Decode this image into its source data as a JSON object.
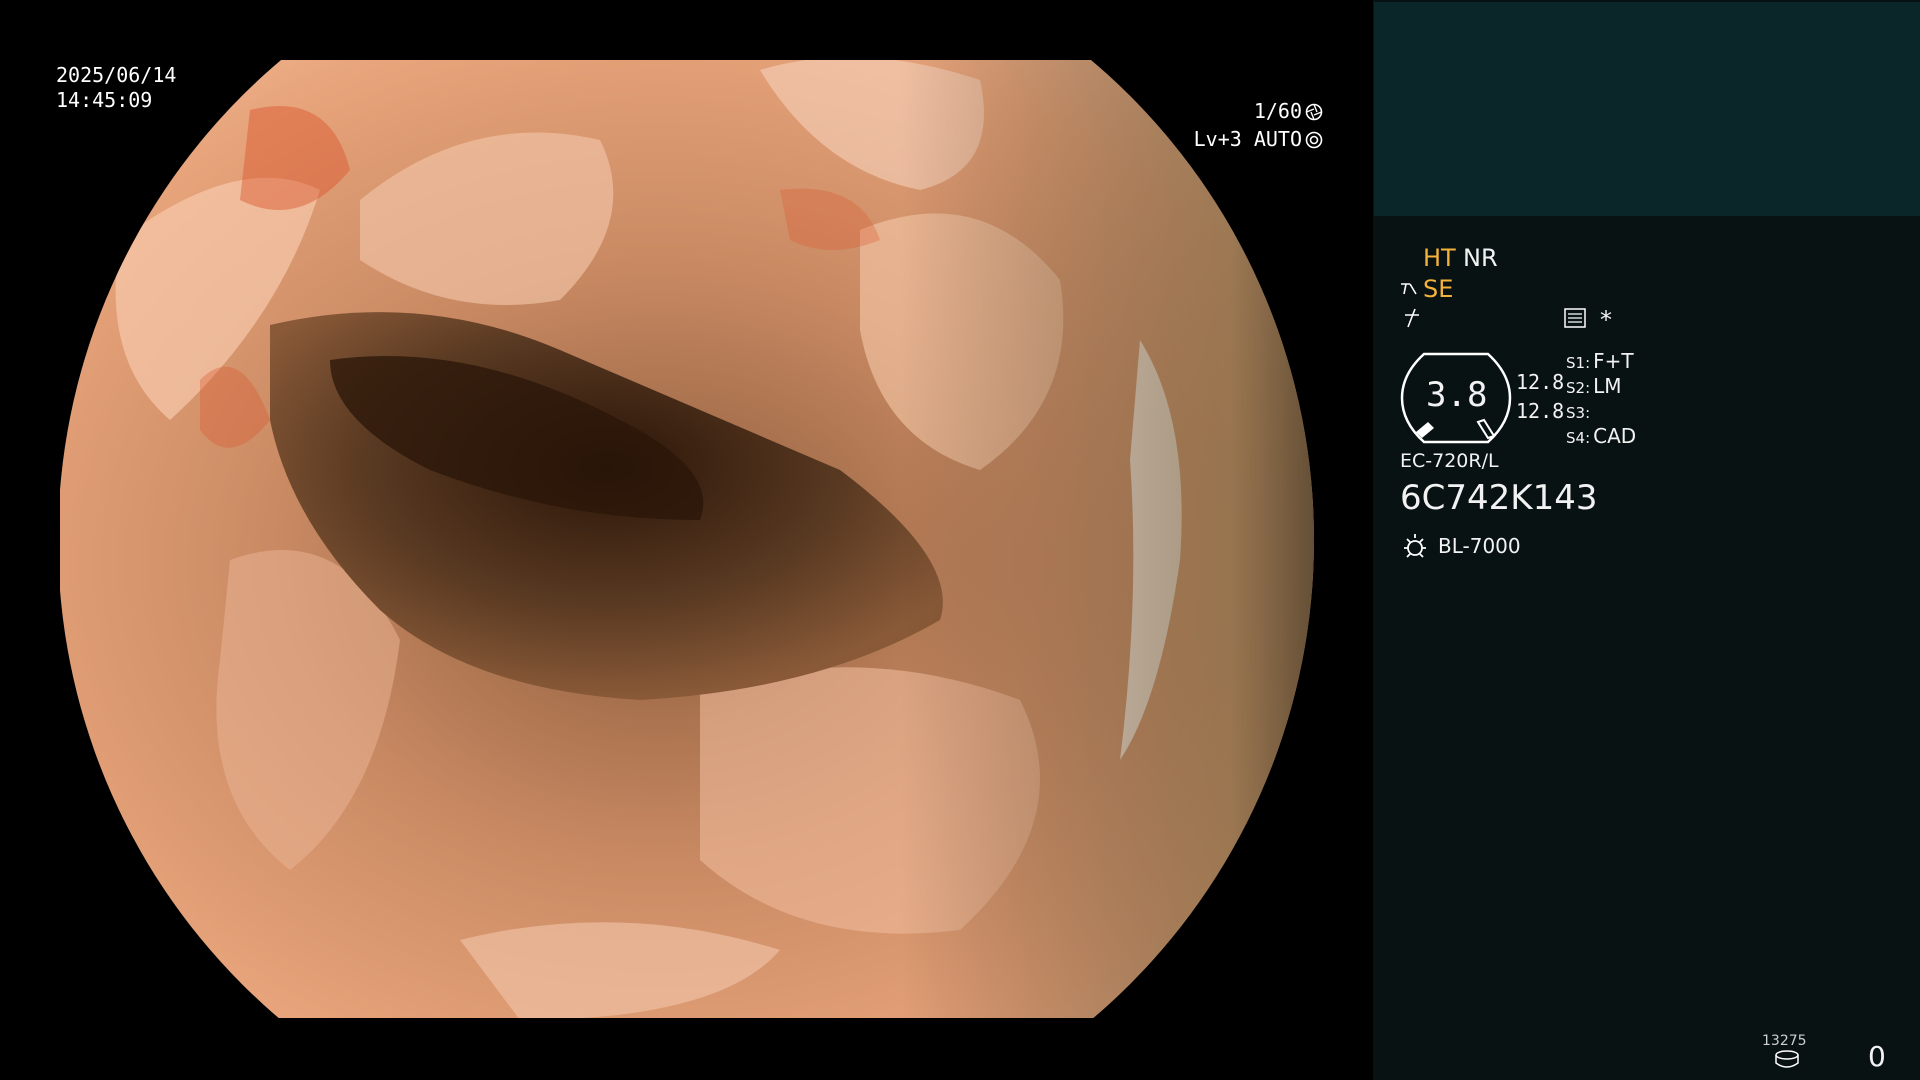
{
  "overlay": {
    "date": "2025/06/14",
    "time": "14:45:09",
    "shutter": "1/60",
    "level": "Lv+3  AUTO"
  },
  "panel": {
    "ht": "HT",
    "nr": "NR",
    "se": "SE",
    "star": "*",
    "gauge_value": "3.8",
    "gauge_r1": "12.8",
    "gauge_r2": "12.8",
    "switches": [
      {
        "key": "S1:",
        "value": "F+T"
      },
      {
        "key": "S2:",
        "value": "LM"
      },
      {
        "key": "S3:",
        "value": ""
      },
      {
        "key": "S4:",
        "value": "CAD"
      }
    ],
    "scope_model": "EC-720R/L",
    "scope_serial": "6C742K143",
    "light_source": "BL-7000",
    "image_count": "13275",
    "counter": "0"
  },
  "colors": {
    "panel_bg": "#081212",
    "panel_top_bg": "#0b2628",
    "accent": "#f4b23c"
  }
}
